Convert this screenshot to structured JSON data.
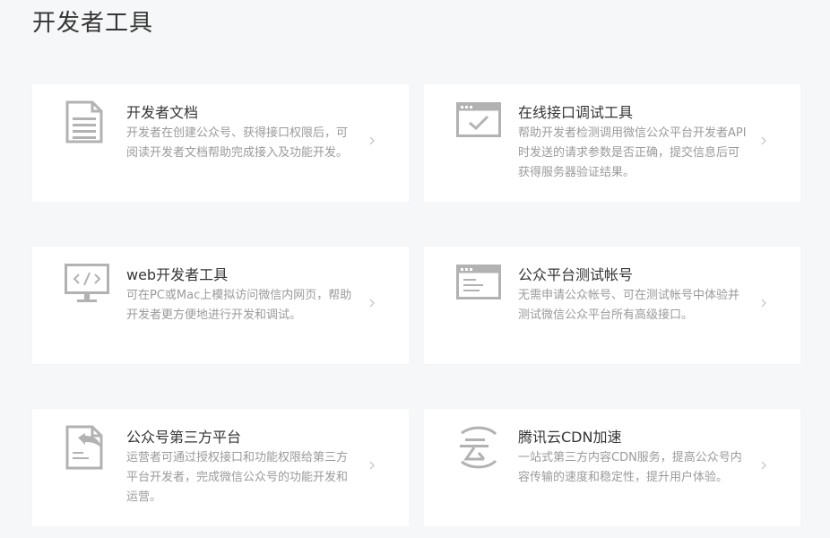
{
  "page": {
    "title": "开发者工具"
  },
  "cards": [
    {
      "title": "开发者文档",
      "desc": "开发者在创建公众号、获得接口权限后，可阅读开发者文档帮助完成接入及功能开发。",
      "icon": "document-icon"
    },
    {
      "title": "在线接口调试工具",
      "desc": "帮助开发者检测调用微信公众平台开发者API时发送的请求参数是否正确，提交信息后可获得服务器验证结果。",
      "icon": "window-check-icon"
    },
    {
      "title": "web开发者工具",
      "desc": "可在PC或Mac上模拟访问微信内网页，帮助开发者更方便地进行开发和调试。",
      "icon": "monitor-code-icon"
    },
    {
      "title": "公众平台测试帐号",
      "desc": "无需申请公众帐号、可在测试帐号中体验并测试微信公众平台所有高级接口。",
      "icon": "window-text-icon"
    },
    {
      "title": "公众号第三方平台",
      "desc": "运营者可通过授权接口和功能权限给第三方平台开发者，完成微信公众号的功能开发和运营。",
      "icon": "document-share-icon"
    },
    {
      "title": "腾讯云CDN加速",
      "desc": "一站式第三方内容CDN服务，提高公众号内容传输的速度和稳定性，提升用户体验。",
      "icon": "cloud-icon"
    }
  ],
  "colors": {
    "background": "#f6f7f8",
    "card": "#ffffff",
    "title_text": "#353535",
    "desc_text": "#9a9a9a",
    "icon_gray": "#b2b2b2"
  }
}
